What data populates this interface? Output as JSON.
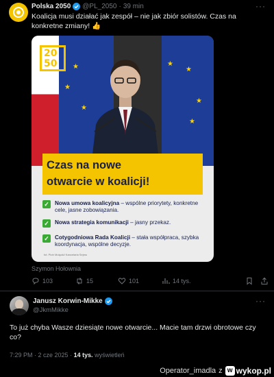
{
  "post1": {
    "author_name": "Polska 2050",
    "handle": "@PL_2050",
    "separator": "·",
    "time": "39 min",
    "text": "Koalicja musi działać jak zespół – nie jak zbiór solistów. Czas na konkretne zmiany! 👍",
    "image": {
      "logo_text": "20 50",
      "headline_line1": "Czas na nowe",
      "headline_line2": "otwarcie w koalicji!",
      "items": [
        {
          "bold": "Nowa umowa koalicyjna",
          "rest": " – wspólne priorytety, konkretne cele, jasne zobowiązania."
        },
        {
          "bold": "Nowa strategia komunikacji",
          "rest": " – jasny przekaz."
        },
        {
          "bold": "Cotygodniowa Rada Koalicji",
          "rest": " – stała współpraca, szybka koordynacja, wspólne decyzje."
        }
      ],
      "credit": "fot. Piotr Molęcki/ Kancelaria Sejmu"
    },
    "caption": "Szymon Hołownia",
    "actions": {
      "replies": "103",
      "reposts": "15",
      "likes": "101",
      "views": "14 tys."
    }
  },
  "post2": {
    "author_name": "Janusz Korwin-Mikke",
    "handle": "@JkmMikke",
    "text": "To już chyba Wasze dziesiąte nowe otwarcie... Macie tam drzwi obrotowe czy co?",
    "time": "7:29 PM",
    "date": "2 cze 2025",
    "views_count": "14 tys.",
    "views_label": "wyświetleń"
  },
  "watermark": {
    "user": "Operator_imadla",
    "z": "z",
    "site": "wykop.pl"
  },
  "colors": {
    "background": "#000000",
    "text": "#e7e9ea",
    "muted": "#71767b",
    "verified": "#1d9bf0",
    "brand_yellow": "#f5c400"
  }
}
